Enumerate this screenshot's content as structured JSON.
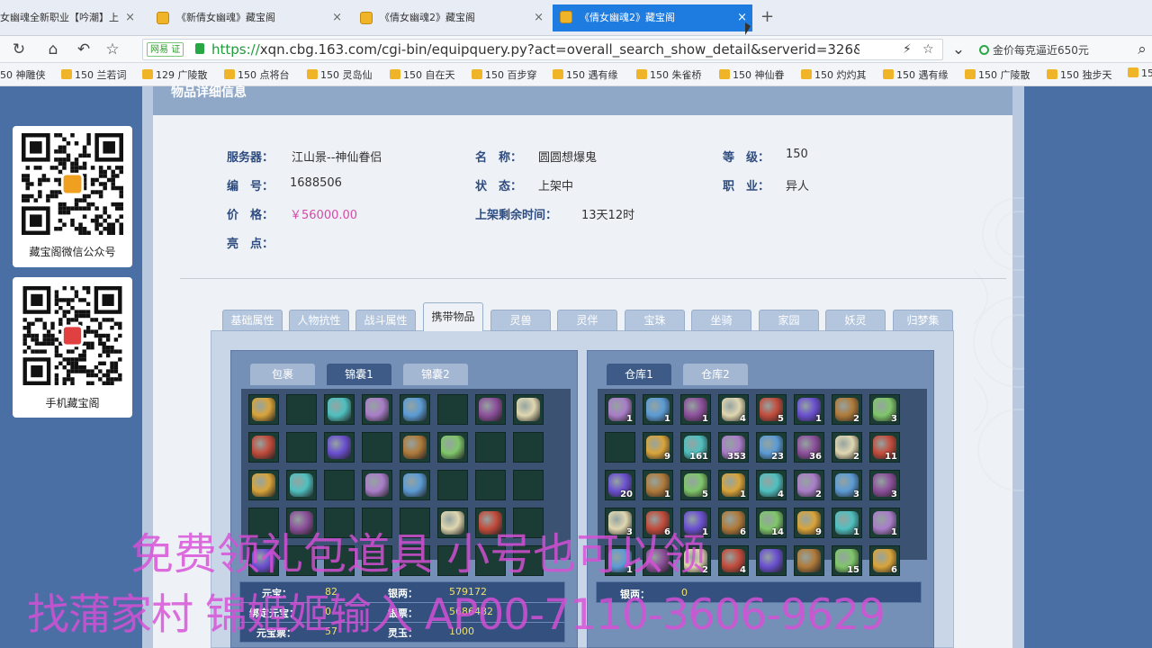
{
  "browser": {
    "tabs": [
      {
        "label": "女幽魂全新职业【吟潮】上"
      },
      {
        "label": "《新倩女幽魂》藏宝阁"
      },
      {
        "label": "《倩女幽魂2》藏宝阁"
      },
      {
        "label": "《倩女幽魂2》藏宝阁"
      }
    ],
    "close_glyph": "×",
    "new_tab_glyph": "+",
    "nav": {
      "refresh": "↻",
      "home": "⌂",
      "back": "↶",
      "star": "☆"
    },
    "shield_label": "网易",
    "shield_badge": "证",
    "url_scheme": "https://",
    "url_rest": "xqn.cbg.163.com/cgi-bin/equipquery.py?act=overall_search_show_detail&serverid=326&equip_id=",
    "url_icons": {
      "bolt": "⚡",
      "star": "☆",
      "dropdown": "⌄"
    },
    "gold_text": "金价每克逼近650元",
    "search_glyph": "⌕",
    "bookmarks": [
      "50 神雕侠",
      "150 兰若词",
      "129 广陵散",
      "150 点将台",
      "150 灵岛仙",
      "150 自在天",
      "150 百步穿",
      "150 遇有缘",
      "150 朱雀桥",
      "150 神仙眷",
      "150 灼灼其",
      "150 遇有缘",
      "150 广陵散",
      "150 独步天",
      "150"
    ],
    "colors": {
      "active_tab": "#1e7be0",
      "https_green": "#1f9b3a"
    }
  },
  "sidebar": {
    "wechat_caption": "藏宝阁微信公众号",
    "mobile_caption": "手机藏宝阁"
  },
  "panel": {
    "header": "物品详细信息",
    "fields": {
      "server_label": "服务器：",
      "server": "江山景--神仙眷侣",
      "name_label": "名　称：",
      "name": "圆圆想爆鬼",
      "level_label": "等　级：",
      "level": "150",
      "id_label": "编　号：",
      "id": "1688506",
      "status_label": "状　态：",
      "status": "上架中",
      "job_label": "职　业：",
      "job": "异人",
      "price_label": "价　格：",
      "price": "￥56000.00",
      "time_label": "上架剩余时间：",
      "time": "13天12时",
      "highlight_label": "亮　点："
    },
    "tabs": [
      "基础属性",
      "人物抗性",
      "战斗属性",
      "携带物品",
      "灵兽",
      "灵伴",
      "宝珠",
      "坐骑",
      "家园",
      "妖灵",
      "归梦集"
    ],
    "active_tab": "携带物品",
    "left_pane": {
      "subtabs": [
        "包裹",
        "锦囊1",
        "锦囊2"
      ],
      "active_subtab": "锦囊1",
      "money": [
        {
          "label": "元宝：",
          "value": "82",
          "label2": "银两：",
          "value2": "579172"
        },
        {
          "label": "绑定元宝：",
          "value": "0",
          "label2": "银票：",
          "value2": "5686482"
        },
        {
          "label": "元宝票：",
          "value": "57",
          "label2": "灵玉：",
          "value2": "1000"
        }
      ]
    },
    "right_pane": {
      "subtabs": [
        "仓库1",
        "仓库2"
      ],
      "active_subtab": "仓库1",
      "money": [
        {
          "label": "银两：",
          "value": "0"
        }
      ],
      "counts": [
        [
          "1",
          "1",
          "1",
          "4",
          "5",
          "1",
          "2",
          "3"
        ],
        [
          "",
          "9",
          "161",
          "353",
          "23",
          "36",
          "2",
          "11"
        ],
        [
          "20",
          "1",
          "5",
          "1",
          "4",
          "2",
          "3",
          "3"
        ],
        [
          "3",
          "6",
          "1",
          "6",
          "14",
          "9",
          "1",
          "1"
        ],
        [
          "1",
          "",
          "2",
          "4",
          "",
          "",
          "15",
          "6"
        ]
      ]
    }
  },
  "overlay": {
    "line1": "免费领礼包道具 小号也可以领",
    "line2": "找蒲家村 锦姬姬输入 AP00-7110-3606-9629",
    "color": "#d94fd8"
  }
}
